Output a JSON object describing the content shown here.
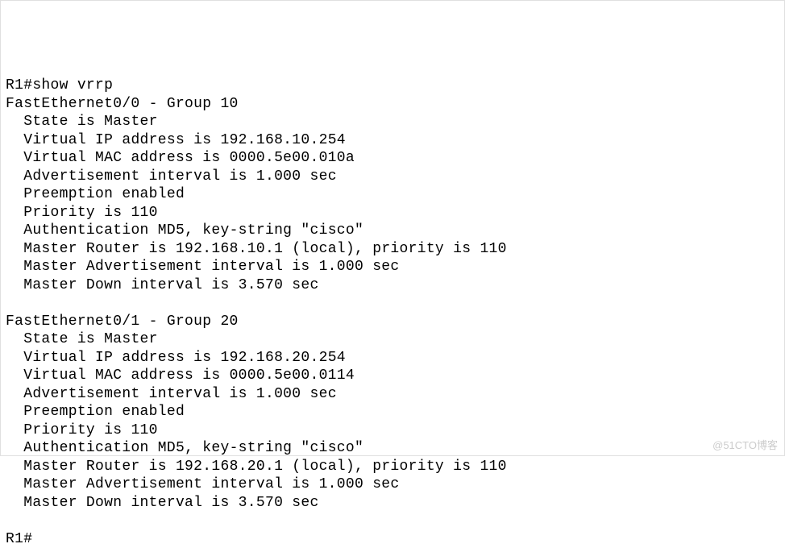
{
  "prompt": "R1#",
  "command": "show vrrp",
  "groups": [
    {
      "interface": "FastEthernet0/0",
      "group_num": "10",
      "state": "Master",
      "virtual_ip": "192.168.10.254",
      "virtual_mac": "0000.5e00.010a",
      "adv_interval": "1.000 sec",
      "preemption": "enabled",
      "priority": "110",
      "auth_method": "MD5",
      "auth_key": "cisco",
      "master_router": "192.168.10.1",
      "master_local": "(local)",
      "master_priority": "110",
      "master_adv_interval": "1.000 sec",
      "master_down_interval": "3.570 sec"
    },
    {
      "interface": "FastEthernet0/1",
      "group_num": "20",
      "state": "Master",
      "virtual_ip": "192.168.20.254",
      "virtual_mac": "0000.5e00.0114",
      "adv_interval": "1.000 sec",
      "preemption": "enabled",
      "priority": "110",
      "auth_method": "MD5",
      "auth_key": "cisco",
      "master_router": "192.168.20.1",
      "master_local": "(local)",
      "master_priority": "110",
      "master_adv_interval": "1.000 sec",
      "master_down_interval": "3.570 sec"
    }
  ],
  "end_prompt": "R1#",
  "watermark": "@51CTO博客"
}
